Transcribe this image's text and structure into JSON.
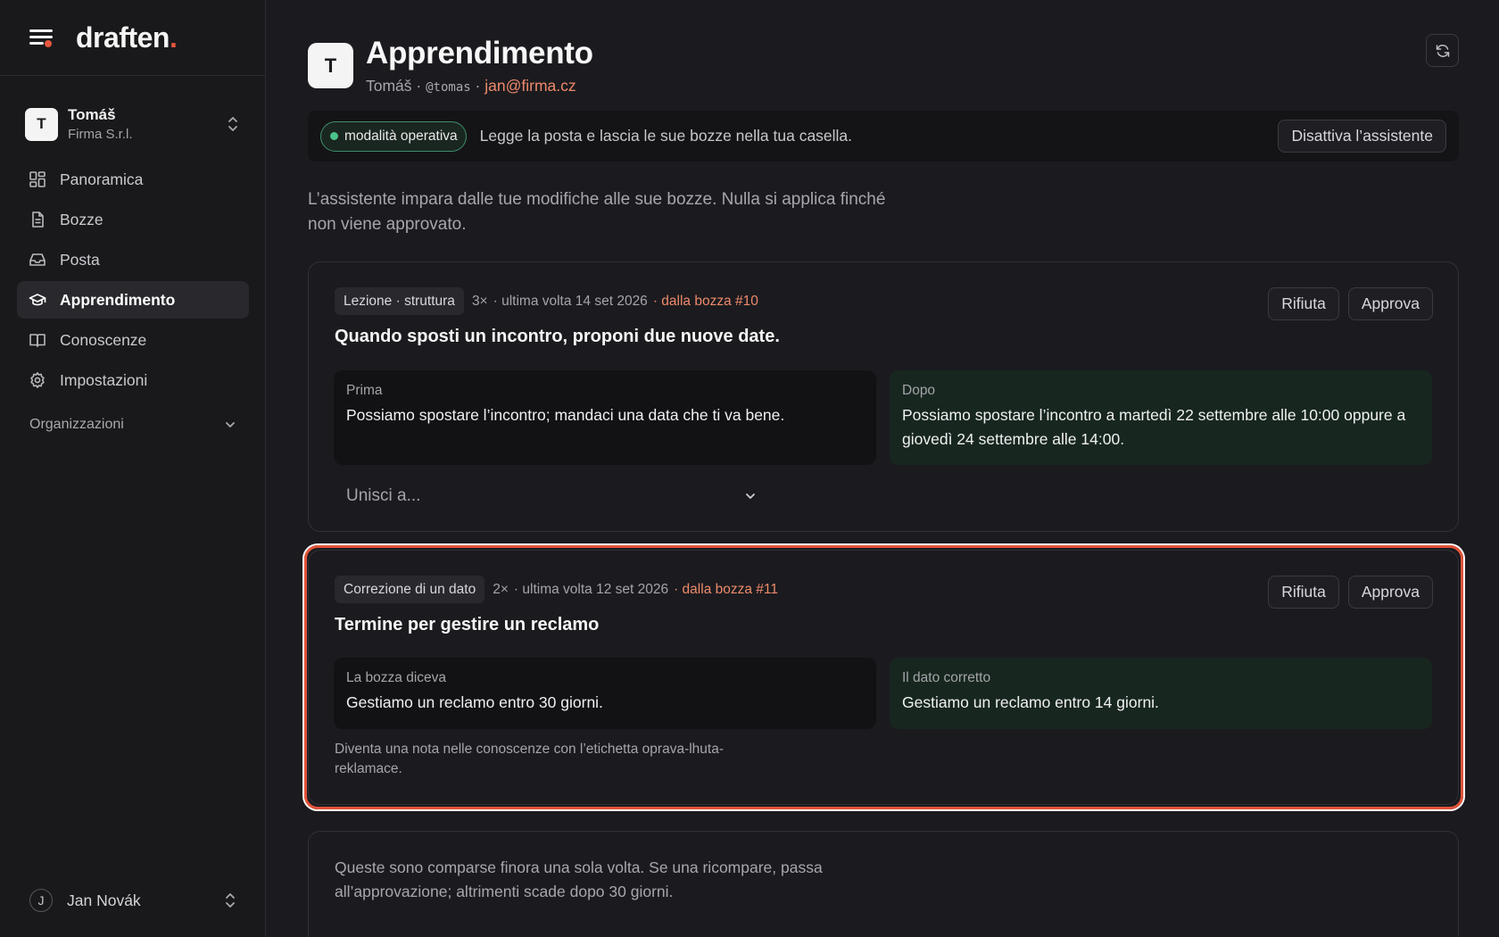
{
  "brand": {
    "name": "draften",
    "dot": "."
  },
  "account": {
    "initial": "T",
    "name": "Tomáš",
    "org": "Firma S.r.l."
  },
  "nav": {
    "items": [
      {
        "label": "Panoramica",
        "icon": "dashboard-icon"
      },
      {
        "label": "Bozze",
        "icon": "document-icon"
      },
      {
        "label": "Posta",
        "icon": "inbox-icon"
      },
      {
        "label": "Apprendimento",
        "icon": "graduation-cap-icon",
        "active": true
      },
      {
        "label": "Conoscenze",
        "icon": "book-icon"
      },
      {
        "label": "Impostazioni",
        "icon": "gear-icon"
      }
    ],
    "section_label": "Organizzazioni"
  },
  "user": {
    "initial": "J",
    "name": "Jan Novák"
  },
  "page": {
    "initial": "T",
    "title": "Apprendimento",
    "sub_name": "Tomáš",
    "sub_sep1": " · ",
    "sub_handle": "@tomas",
    "sub_sep2": " · ",
    "sub_email": "jan@firma.cz"
  },
  "status": {
    "mode_label": "modalità operativa",
    "text": "Legge la posta e lascia le sue bozze nella tua casella.",
    "disable_button": "Disattiva l’assistente"
  },
  "intro": "L’assistente impara dalle tue modifiche alle sue bozze. Nulla si applica finché non viene approvato.",
  "cards": [
    {
      "tag": "Lezione · struttura",
      "count": "3×",
      "last": "· ultima volta 14 set 2026",
      "source": "· dalla bozza #10",
      "title": "Quando sposti un incontro, proponi due nuove date.",
      "reject": "Rifiuta",
      "approve": "Approva",
      "before_label": "Prima",
      "before_text": "Possiamo spostare l’incontro; mandaci una data che ti va bene.",
      "after_label": "Dopo",
      "after_text": "Possiamo spostare l’incontro a martedì 22 settembre alle 10:00 oppure a giovedì 24 settembre alle 14:00.",
      "merge_placeholder": "Unisci a..."
    },
    {
      "tag": "Correzione di un dato",
      "count": "2×",
      "last": "· ultima volta 12 set 2026",
      "source": "· dalla bozza #11",
      "title": "Termine per gestire un reclamo",
      "reject": "Rifiuta",
      "approve": "Approva",
      "before_label": "La bozza diceva",
      "before_text": "Gestiamo un reclamo entro 30 giorni.",
      "after_label": "Il dato corretto",
      "after_text": "Gestiamo un reclamo entro 14 giorni.",
      "note": "Diventa una nota nelle conoscenze con l’etichetta oprava-lhuta-reklamace."
    }
  ],
  "pending": {
    "text": "Queste sono comparse finora una sola volta. Se una ricompare, passa all’approvazione; altrimenti scade dopo 30 giorni."
  },
  "colors": {
    "accent": "#e5573d",
    "link": "#ee8a6a",
    "success": "#4cc28b",
    "highlight": "#e2533a"
  }
}
